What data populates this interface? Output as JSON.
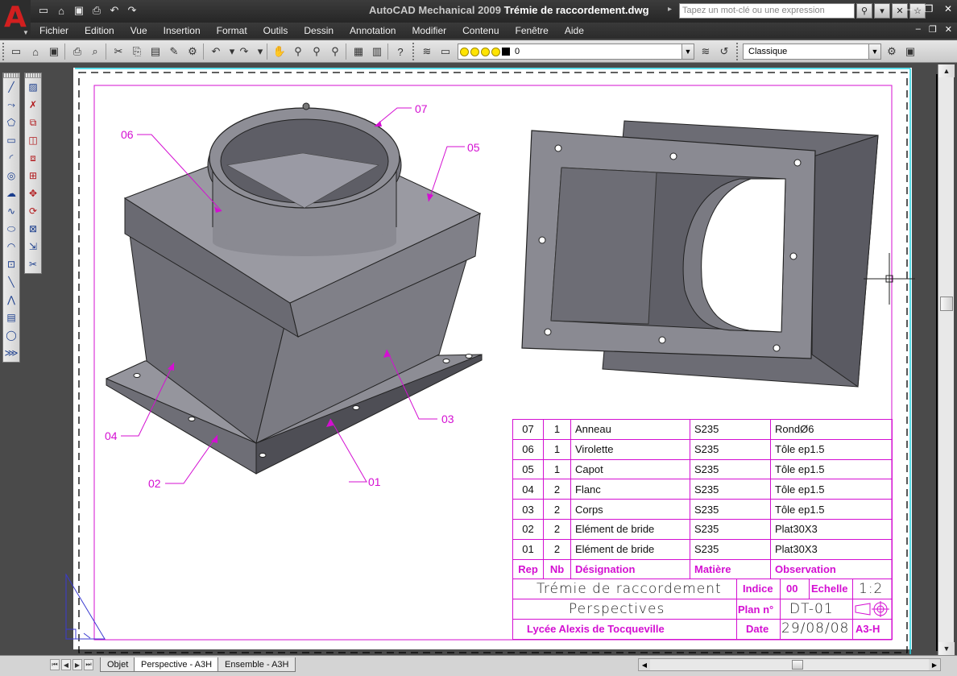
{
  "window": {
    "app_title": "AutoCAD Mechanical 2009",
    "document_title": "Trémie de raccordement.dwg",
    "search_placeholder": "Tapez un mot-clé ou une expression"
  },
  "menu": [
    "Fichier",
    "Edition",
    "Vue",
    "Insertion",
    "Format",
    "Outils",
    "Dessin",
    "Annotation",
    "Modifier",
    "Contenu",
    "Fenêtre",
    "Aide"
  ],
  "toolbar": {
    "layer_value": "0",
    "workspace_value": "Classique"
  },
  "drawing": {
    "callouts": [
      "01",
      "02",
      "03",
      "04",
      "05",
      "06",
      "07"
    ]
  },
  "parts_list": {
    "header": {
      "rep": "Rep",
      "nb": "Nb",
      "designation": "Désignation",
      "matiere": "Matière",
      "observation": "Observation"
    },
    "rows": [
      {
        "rep": "07",
        "nb": "1",
        "designation": "Anneau",
        "matiere": "S235",
        "observation": "RondØ6"
      },
      {
        "rep": "06",
        "nb": "1",
        "designation": "Virolette",
        "matiere": "S235",
        "observation": "Tôle ep1.5"
      },
      {
        "rep": "05",
        "nb": "1",
        "designation": "Capot",
        "matiere": "S235",
        "observation": "Tôle ep1.5"
      },
      {
        "rep": "04",
        "nb": "2",
        "designation": "Flanc",
        "matiere": "S235",
        "observation": "Tôle ep1.5"
      },
      {
        "rep": "03",
        "nb": "2",
        "designation": "Corps",
        "matiere": "S235",
        "observation": "Tôle ep1.5"
      },
      {
        "rep": "02",
        "nb": "2",
        "designation": "Elément de bride",
        "matiere": "S235",
        "observation": "Plat30X3"
      },
      {
        "rep": "01",
        "nb": "2",
        "designation": "Elément de bride",
        "matiere": "S235",
        "observation": "Plat30X3"
      }
    ]
  },
  "title_block": {
    "title": "Trémie de raccordement",
    "indice_label": "Indice",
    "indice_value": "00",
    "echelle_label": "Echelle",
    "echelle_value": "1:2",
    "subtitle": "Perspectives",
    "plan_label": "Plan n°",
    "plan_value": "DT-01",
    "school": "Lycée Alexis de Tocqueville",
    "date_label": "Date",
    "date_value": "29/08/08",
    "format": "A3-H"
  },
  "layout_tabs": [
    "Objet",
    "Perspective - A3H",
    "Ensemble - A3H"
  ],
  "colors": {
    "annotation_magenta": "#d40fd2",
    "logo_red": "#d21f1f",
    "chrome_dark": "#2b2b2b"
  }
}
